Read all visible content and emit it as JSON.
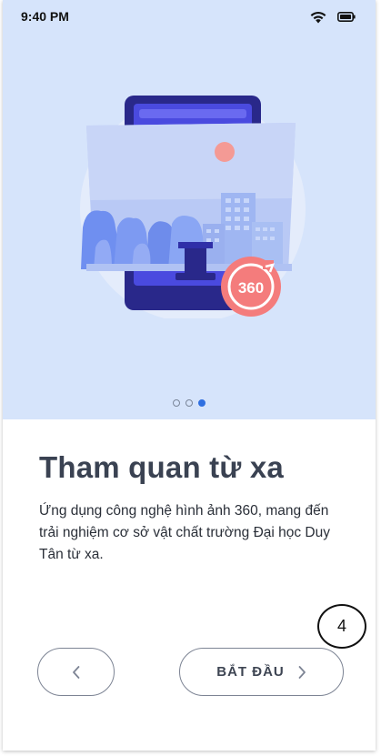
{
  "status_bar": {
    "time": "9:40 PM",
    "icons": [
      "wifi-icon",
      "battery-icon"
    ]
  },
  "illustration": {
    "badge_text": "360",
    "description_icon": "360-view-illustration"
  },
  "pager": {
    "total": 3,
    "active_index": 2
  },
  "onboarding": {
    "title": "Tham quan từ xa",
    "description": "Ứng dụng công nghệ hình ảnh 360, mang đến trải nghiệm cơ sở vật chất trường Đại học Duy Tân từ xa."
  },
  "badge": {
    "number": "4"
  },
  "buttons": {
    "back_icon": "chevron-left-icon",
    "start_label": "BẮT ĐẦU",
    "start_icon": "chevron-right-icon"
  },
  "colors": {
    "hero_bg": "#d6e4fb",
    "accent_dot": "#2f6fe0",
    "badge_360": "#f47c7c",
    "device": "#2b2a8c"
  }
}
